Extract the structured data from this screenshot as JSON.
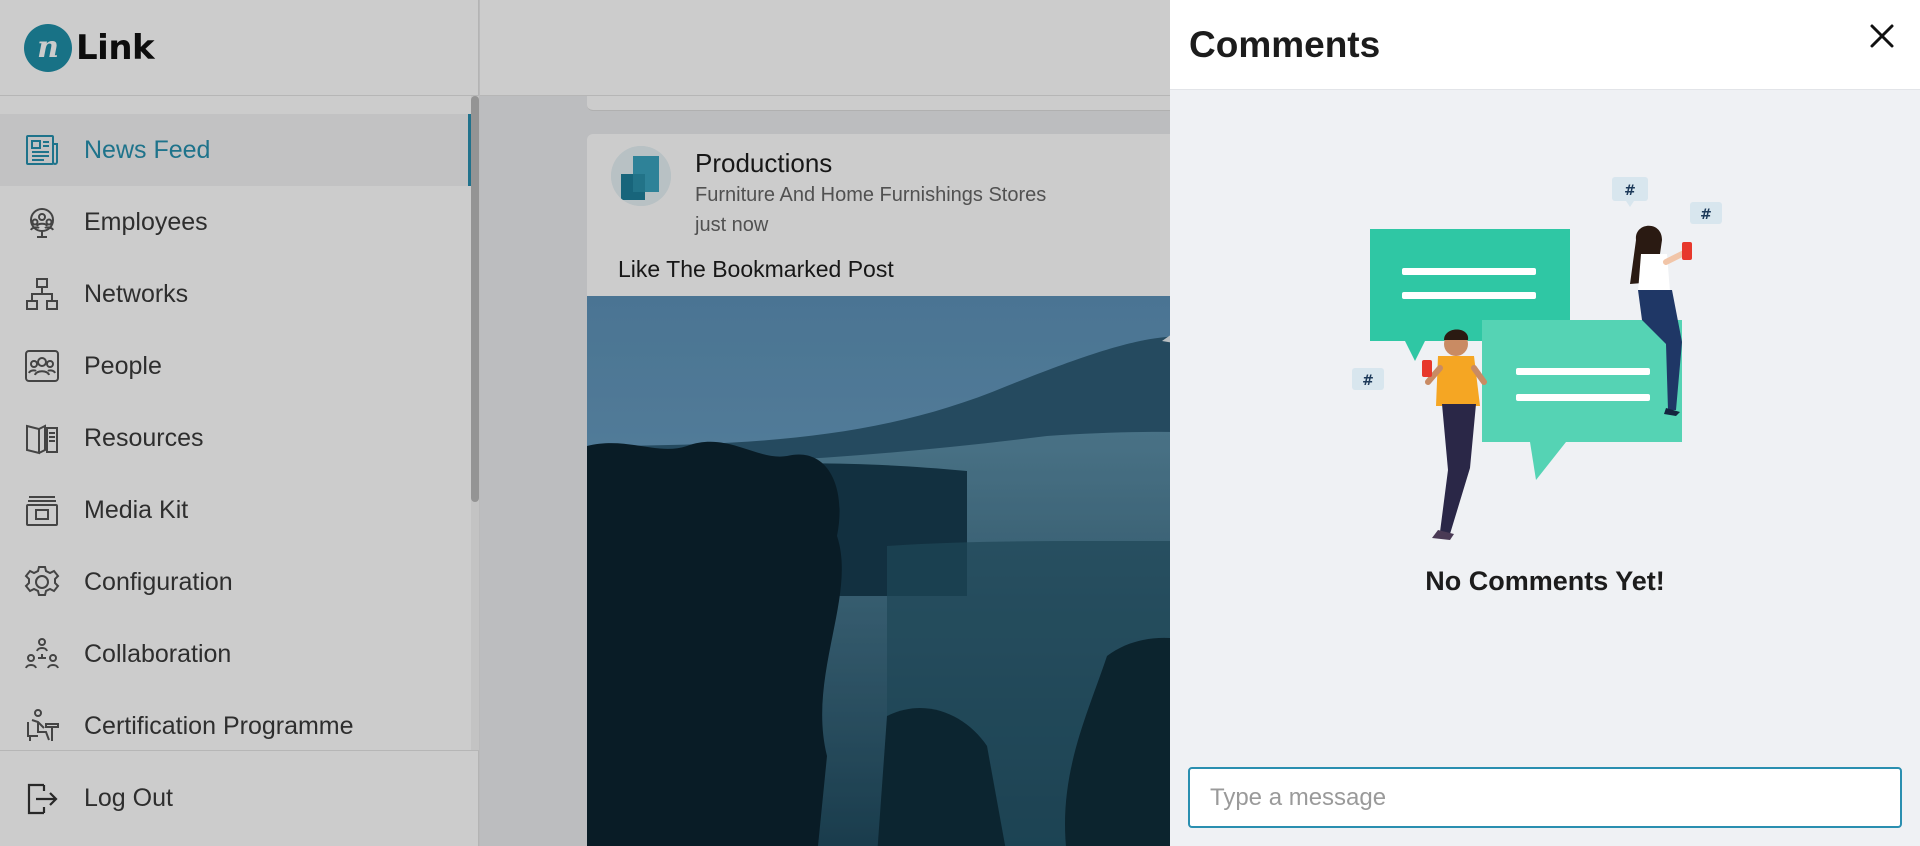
{
  "app": {
    "logo_letter": "n",
    "logo_text": "Link"
  },
  "sidebar": {
    "items": [
      {
        "label": "News Feed",
        "icon": "news-feed-icon",
        "active": true
      },
      {
        "label": "Employees",
        "icon": "employees-icon",
        "active": false
      },
      {
        "label": "Networks",
        "icon": "networks-icon",
        "active": false
      },
      {
        "label": "People",
        "icon": "people-icon",
        "active": false
      },
      {
        "label": "Resources",
        "icon": "resources-icon",
        "active": false
      },
      {
        "label": "Media Kit",
        "icon": "media-kit-icon",
        "active": false
      },
      {
        "label": "Configuration",
        "icon": "gear-icon",
        "active": false
      },
      {
        "label": "Collaboration",
        "icon": "collaboration-icon",
        "active": false
      },
      {
        "label": "Certification Programme",
        "icon": "certification-icon",
        "active": false
      }
    ],
    "logout_label": "Log Out"
  },
  "post": {
    "author": "Productions",
    "category": "Furniture And Home Furnishings Stores",
    "time": "just now",
    "text": "Like The Bookmarked Post"
  },
  "comments_panel": {
    "title": "Comments",
    "empty_text": "No Comments Yet!",
    "input_placeholder": "Type a message",
    "input_value": ""
  },
  "colors": {
    "accent": "#2a8fb0",
    "illustration_teal": "#2fc7a4"
  }
}
